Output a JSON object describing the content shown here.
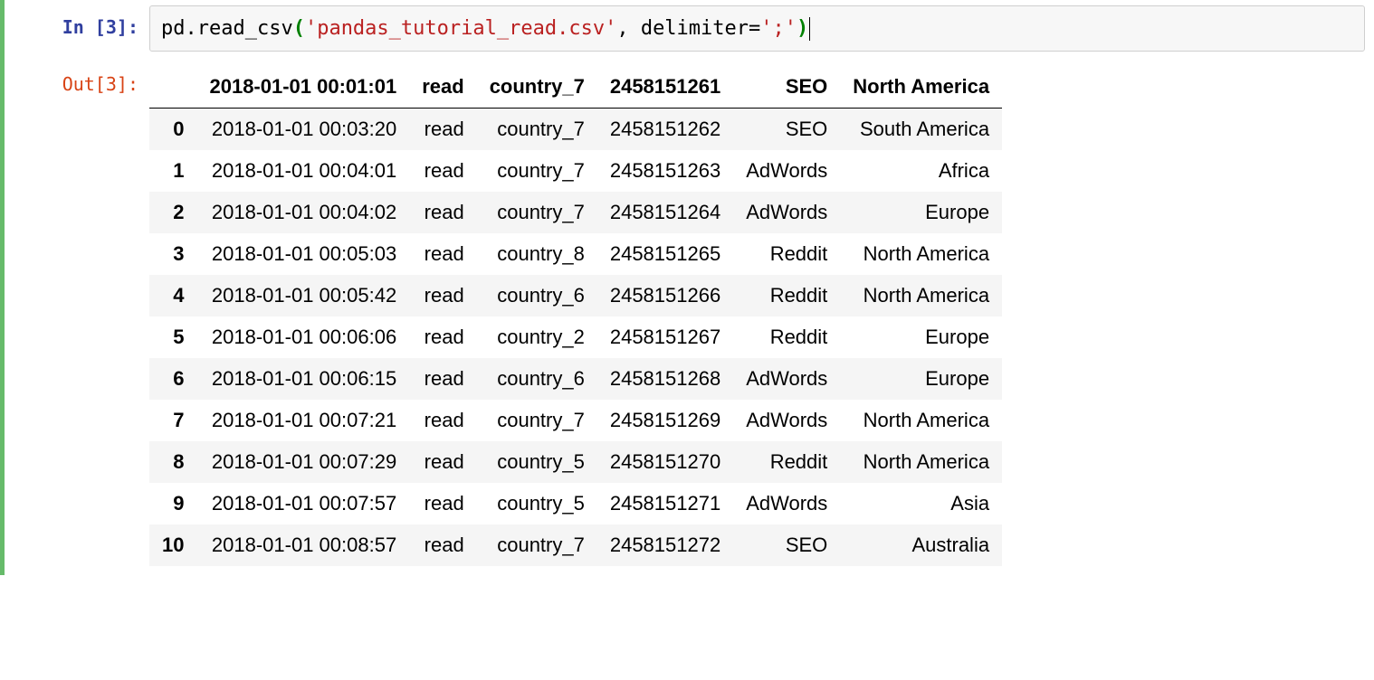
{
  "colors": {
    "selected_border": "#66BB6A",
    "in_prompt": "#303F9F",
    "out_prompt": "#D84315",
    "paren_highlight": "#008000",
    "string_literal": "#BA2121"
  },
  "cell": {
    "exec_count": 3,
    "in_prompt_prefix": "In [",
    "in_prompt_suffix": "]:",
    "out_prompt_prefix": "Out[",
    "out_prompt_suffix": "]:",
    "code": {
      "pre_paren": "pd.read_csv",
      "open_paren": "(",
      "string_literal": "'pandas_tutorial_read.csv'",
      "mid": ", delimiter=",
      "string_literal2": "';'",
      "close_paren": ")"
    }
  },
  "dataframe": {
    "columns": [
      "2018-01-01 00:01:01",
      "read",
      "country_7",
      "2458151261",
      "SEO",
      "North America"
    ],
    "index": [
      "0",
      "1",
      "2",
      "3",
      "4",
      "5",
      "6",
      "7",
      "8",
      "9",
      "10"
    ],
    "rows": [
      [
        "2018-01-01 00:03:20",
        "read",
        "country_7",
        "2458151262",
        "SEO",
        "South America"
      ],
      [
        "2018-01-01 00:04:01",
        "read",
        "country_7",
        "2458151263",
        "AdWords",
        "Africa"
      ],
      [
        "2018-01-01 00:04:02",
        "read",
        "country_7",
        "2458151264",
        "AdWords",
        "Europe"
      ],
      [
        "2018-01-01 00:05:03",
        "read",
        "country_8",
        "2458151265",
        "Reddit",
        "North America"
      ],
      [
        "2018-01-01 00:05:42",
        "read",
        "country_6",
        "2458151266",
        "Reddit",
        "North America"
      ],
      [
        "2018-01-01 00:06:06",
        "read",
        "country_2",
        "2458151267",
        "Reddit",
        "Europe"
      ],
      [
        "2018-01-01 00:06:15",
        "read",
        "country_6",
        "2458151268",
        "AdWords",
        "Europe"
      ],
      [
        "2018-01-01 00:07:21",
        "read",
        "country_7",
        "2458151269",
        "AdWords",
        "North America"
      ],
      [
        "2018-01-01 00:07:29",
        "read",
        "country_5",
        "2458151270",
        "Reddit",
        "North America"
      ],
      [
        "2018-01-01 00:07:57",
        "read",
        "country_5",
        "2458151271",
        "AdWords",
        "Asia"
      ],
      [
        "2018-01-01 00:08:57",
        "read",
        "country_7",
        "2458151272",
        "SEO",
        "Australia"
      ]
    ]
  }
}
